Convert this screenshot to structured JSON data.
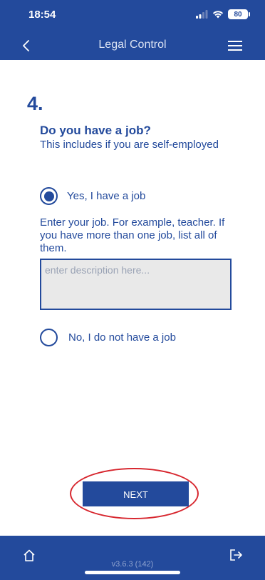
{
  "status_bar": {
    "time": "18:54",
    "battery": "80",
    "icons": [
      "signal-icon",
      "wifi-icon",
      "battery-icon"
    ]
  },
  "header": {
    "title": "Legal Control",
    "back_icon": "chevron-left-icon",
    "menu_icon": "hamburger-menu-icon"
  },
  "question": {
    "number": "4.",
    "title": "Do you have a job?",
    "subtitle": "This includes if you are self-employed",
    "options": [
      {
        "label": "Yes, I have a job",
        "selected": true
      },
      {
        "label": "No, I do not have a job",
        "selected": false
      }
    ],
    "job_hint": "Enter your job. For example, teacher. If you have more than one job, list all of them.",
    "job_placeholder": "enter description here...",
    "job_value": ""
  },
  "actions": {
    "next_label": "NEXT",
    "highlight_color": "#d7262e"
  },
  "footer": {
    "version": "v3.6.3 (142)",
    "home_icon": "home-icon",
    "logout_icon": "logout-icon"
  },
  "colors": {
    "primary": "#234a9c",
    "textarea_bg": "#e9e9e9",
    "background": "#ffffff"
  }
}
